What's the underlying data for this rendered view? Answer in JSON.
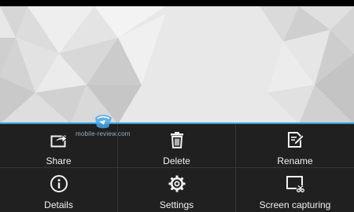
{
  "watermark": {
    "text": "mobile-review.com"
  },
  "menu": {
    "items": [
      {
        "label": "Share",
        "icon": "share-icon"
      },
      {
        "label": "Delete",
        "icon": "trash-icon"
      },
      {
        "label": "Rename",
        "icon": "edit-icon"
      },
      {
        "label": "Details",
        "icon": "info-icon"
      },
      {
        "label": "Settings",
        "icon": "gear-icon"
      },
      {
        "label": "Screen capturing",
        "icon": "screen-capture-icon"
      }
    ]
  },
  "colors": {
    "accent": "#2f9fe0",
    "menu_background": "#202020",
    "wallpaper": "#e6e6e6"
  }
}
